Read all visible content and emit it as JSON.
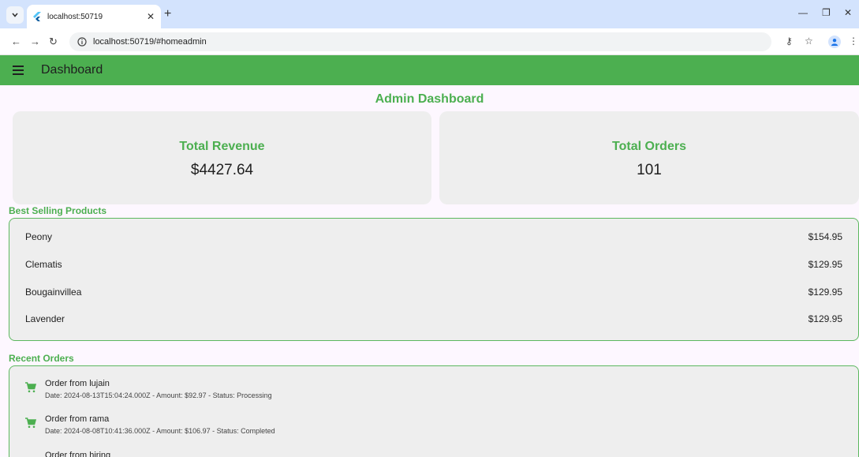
{
  "browser": {
    "tab_title": "localhost:50719",
    "url": "localhost:50719/#homeadmin"
  },
  "appbar": {
    "title": "Dashboard"
  },
  "dashboard": {
    "heading": "Admin Dashboard",
    "total_revenue": {
      "label": "Total Revenue",
      "value": "$4427.64"
    },
    "total_orders": {
      "label": "Total Orders",
      "value": "101"
    }
  },
  "best_selling": {
    "title": "Best Selling Products",
    "products": [
      {
        "name": "Peony",
        "price": "$154.95"
      },
      {
        "name": "Clematis",
        "price": "$129.95"
      },
      {
        "name": "Bougainvillea",
        "price": "$129.95"
      },
      {
        "name": "Lavender",
        "price": "$129.95"
      }
    ]
  },
  "recent_orders": {
    "title": "Recent Orders",
    "orders": [
      {
        "title": "Order from lujain",
        "details": "Date: 2024-08-13T15:04:24.000Z - Amount: $92.97 - Status: Processing"
      },
      {
        "title": "Order from rama",
        "details": "Date: 2024-08-08T10:41:36.000Z - Amount: $106.97 - Status: Completed"
      },
      {
        "title": "Order from hiring"
      }
    ]
  },
  "colors": {
    "primary": "#4caf50",
    "card": "#eeeeee",
    "background": "#fdf7ff"
  }
}
